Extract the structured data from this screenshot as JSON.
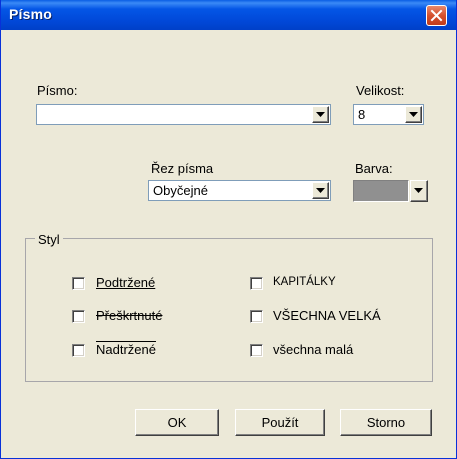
{
  "window": {
    "title": "Písmo",
    "titlebar_color": "#0054e3",
    "close_color": "#d5512e"
  },
  "font": {
    "label": "Písmo:",
    "value": ""
  },
  "size": {
    "label": "Velikost:",
    "value": "8"
  },
  "style": {
    "label": "Řez písma",
    "value": "Obyčejné"
  },
  "color": {
    "label": "Barva:",
    "swatch": "#909090"
  },
  "styl_group": {
    "label": "Styl",
    "options": [
      {
        "label": "Podtržené",
        "checked": false
      },
      {
        "label": "Přeškrtnuté",
        "checked": false
      },
      {
        "label": "Nadtržené",
        "checked": false
      },
      {
        "label": "KAPITÁLKY",
        "checked": false
      },
      {
        "label": "VŠECHNA VELKÁ",
        "checked": false
      },
      {
        "label": "všechna malá",
        "checked": false
      }
    ]
  },
  "buttons": {
    "ok": "OK",
    "apply": "Použít",
    "cancel": "Storno"
  }
}
